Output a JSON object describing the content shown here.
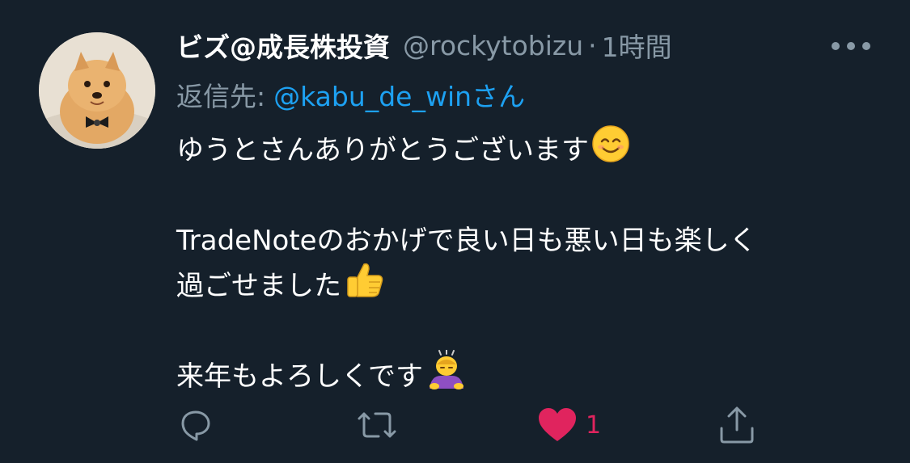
{
  "tweet": {
    "author_name": "ビズ@成長株投資",
    "author_handle": "@rockytobizu",
    "separator": "·",
    "timestamp": "1時間",
    "reply_to_prefix": "返信先:",
    "reply_to_mention": "@kabu_de_winさん",
    "lines": [
      "ゆうとさんありがとうございます",
      "",
      "TradeNoteのおかげで良い日も悪い日も楽しく",
      "過ごせました",
      "",
      "来年もよろしくです"
    ],
    "like_count": "1"
  },
  "icons": {
    "avatar": "pomeranian-dog-photo",
    "more": "more-options-icon",
    "reply": "reply-icon",
    "retweet": "retweet-icon",
    "like": "heart-icon",
    "share": "share-icon",
    "emoji_1": "smiling-face-emoji",
    "emoji_2": "thumbs-up-emoji",
    "emoji_3": "person-bowing-emoji"
  },
  "colors": {
    "background": "#15202b",
    "text_primary": "#ffffff",
    "text_secondary": "#8899a6",
    "link": "#1da1f2",
    "like": "#e0245e"
  }
}
